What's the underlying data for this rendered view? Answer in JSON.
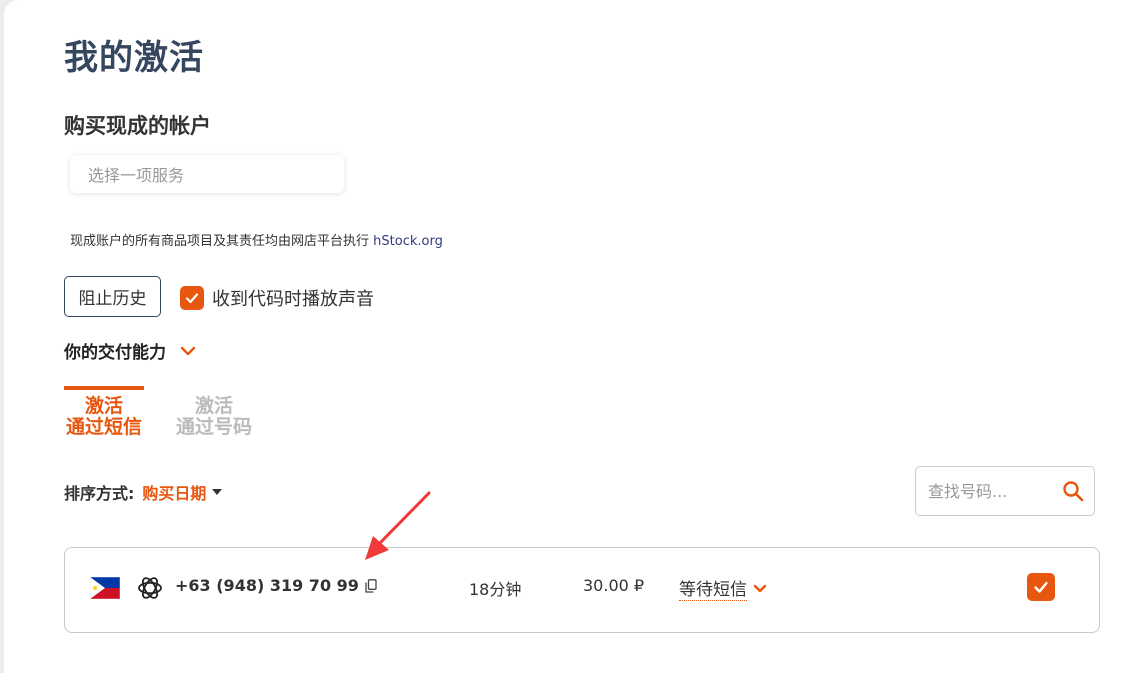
{
  "page": {
    "title": "我的激活"
  },
  "ready_accounts": {
    "heading": "购买现成的帐户",
    "select_placeholder": "选择一项服务",
    "notice_text": "现成账户的所有商品项目及其责任均由网店平台执行",
    "notice_link": "hStock.org"
  },
  "controls": {
    "history_button": "阻止历史",
    "sound_label": "收到代码时播放声音",
    "sound_checked": true,
    "capacity_label": "你的交付能力"
  },
  "tabs": [
    {
      "line1": "激活",
      "line2": "通过短信",
      "active": true
    },
    {
      "line1": "激活",
      "line2": "通过号码",
      "active": false
    }
  ],
  "sort": {
    "label": "排序方式:",
    "value": "购买日期"
  },
  "search": {
    "placeholder": "查找号码..."
  },
  "activations": [
    {
      "country_flag": "philippines-flag",
      "service_icon": "openai-icon",
      "phone": "+63 (948) 319 70 99",
      "duration": "18分钟",
      "price": "30.00 ₽",
      "status": "等待短信",
      "checked": true
    }
  ],
  "colors": {
    "accent": "#e8570f",
    "title": "#34475e",
    "link": "#333a80"
  }
}
